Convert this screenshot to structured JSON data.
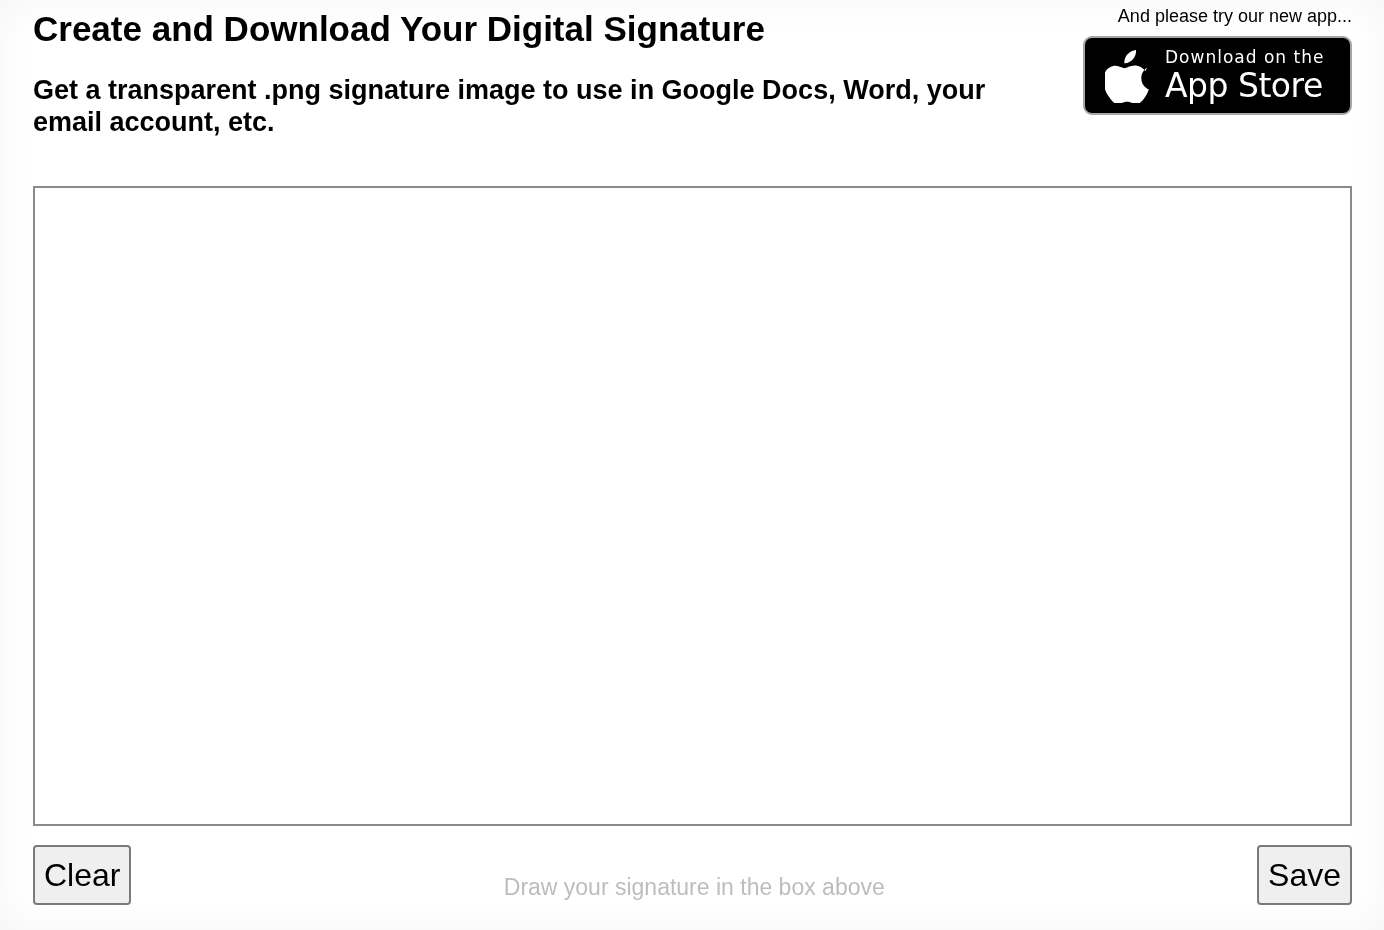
{
  "header": {
    "title": "Create and Download Your Digital Signature",
    "subtitle": "Get a transparent .png signature image to use in Google Docs, Word, your email account, etc."
  },
  "promo": {
    "caption": "And please try our new app...",
    "badge": {
      "line_1": "Download on the",
      "line_2": "App Store"
    }
  },
  "footer": {
    "left_button": "Clear",
    "hint": "Draw your signature in the box above",
    "right_button": "Save"
  }
}
